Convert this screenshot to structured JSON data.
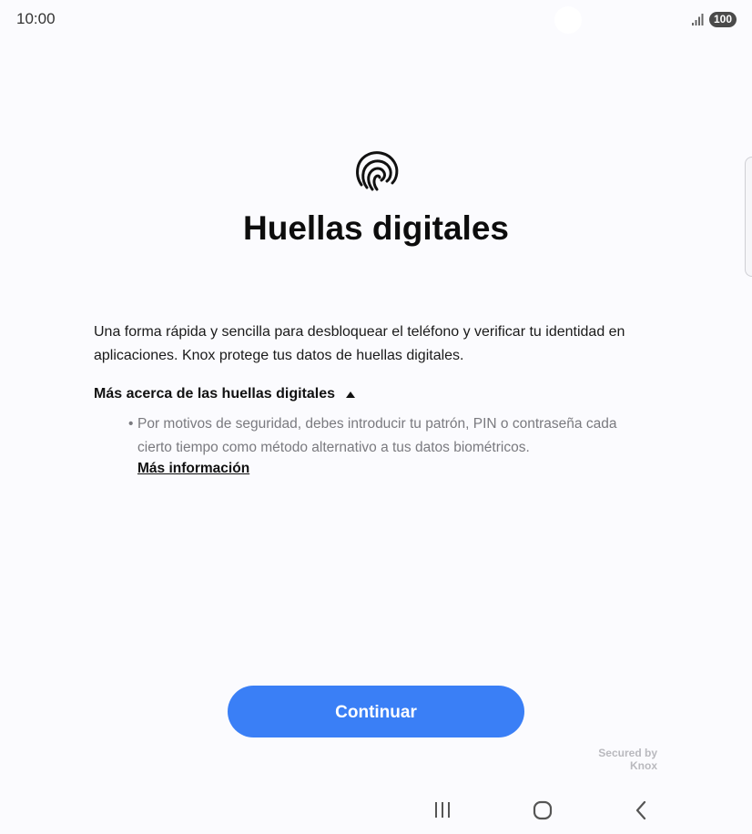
{
  "status_bar": {
    "time": "10:00",
    "battery": "100",
    "signal_icon": "signal-bars-icon"
  },
  "main": {
    "icon": "fingerprint-icon",
    "title": "Huellas digitales",
    "description": "Una forma rápida y sencilla para desbloquear el teléfono y verificar tu identidad en aplicaciones. Knox protege tus datos de huellas digitales.",
    "more_toggle_label": "Más acerca de las huellas digitales",
    "more_toggle_icon": "triangle-up-icon",
    "bullet_marker": "•",
    "bullet_text": "Por motivos de seguridad, debes introducir tu patrón, PIN o contraseña cada cierto tiempo como método alternativo a tus datos biométricos.",
    "more_info_link": "Más información"
  },
  "footer": {
    "continue_label": "Continuar",
    "secured_by_line1": "Secured by",
    "secured_by_line2": "Knox"
  },
  "nav_bar": {
    "recents_icon": "recents-icon",
    "home_icon": "home-icon",
    "back_icon": "back-icon"
  },
  "colors": {
    "background": "#fbfbfe",
    "accent": "#3a7ff6",
    "secondary_text": "#7a7a7f"
  }
}
